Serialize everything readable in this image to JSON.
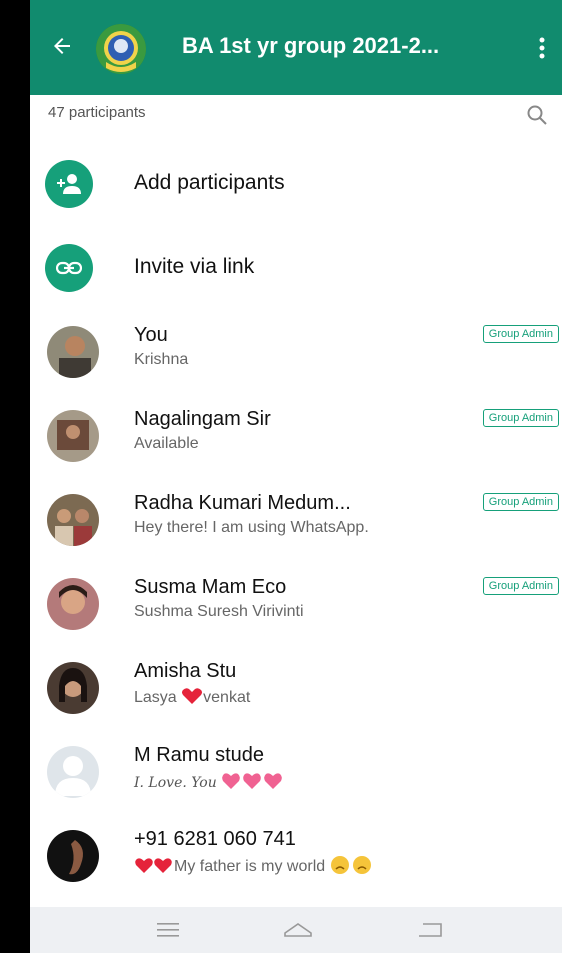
{
  "header": {
    "title": "BA 1st yr group 2021-2..."
  },
  "participants": {
    "count_label": "47 participants"
  },
  "actions": {
    "add": "Add participants",
    "invite": "Invite via link"
  },
  "members": [
    {
      "name": "You",
      "status": "Krishna",
      "badge": "Group Admin"
    },
    {
      "name": "Nagalingam Sir",
      "status": "Available",
      "badge": "Group Admin"
    },
    {
      "name": "Radha Kumari Medum...",
      "status": "Hey there! I am using WhatsApp.",
      "badge": "Group Admin"
    },
    {
      "name": "Susma Mam Eco",
      "status": "Sushma Suresh Virivinti",
      "badge": "Group Admin"
    },
    {
      "name": "Amisha Stu",
      "status_pre": "Lasya ",
      "status_post": "venkat"
    },
    {
      "name": "M Ramu stude",
      "status": "I. Love. You"
    },
    {
      "name": "+91 6281 060 741",
      "status": "My father is my world"
    }
  ],
  "colors": {
    "header": "#118b6e",
    "accent": "#16a07a"
  }
}
